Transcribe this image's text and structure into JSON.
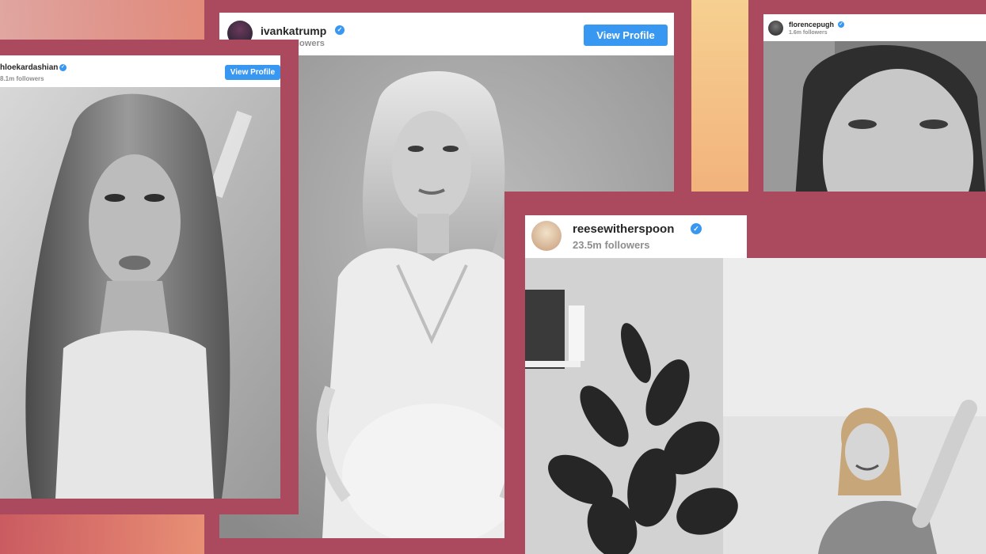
{
  "posts": {
    "khloe": {
      "username": "hloekardashian",
      "followers": "8.1m followers",
      "button": "View Profile",
      "photo": "bw-portrait-woman-long-wavy-hair"
    },
    "ivanka": {
      "username": "ivankatrump",
      "followers": "lowers",
      "button": "View Profile",
      "photo": "bw-portrait-pregnant-woman-white-dress"
    },
    "reese": {
      "username": "reesewitherspoon",
      "followers": "23.5m followers",
      "photo": "bw-room-with-plant-and-waving-woman"
    },
    "florence": {
      "username": "florencepugh",
      "followers": "1.6m followers",
      "photo": "bw-selfie-woman-smiling"
    }
  },
  "colors": {
    "frame": "#ab4a5f",
    "verified": "#3897f0",
    "button": "#3897f0",
    "background_gradient": [
      "#c2606a",
      "#f2be86"
    ]
  },
  "icons": {
    "verified": "verified-check-icon"
  }
}
